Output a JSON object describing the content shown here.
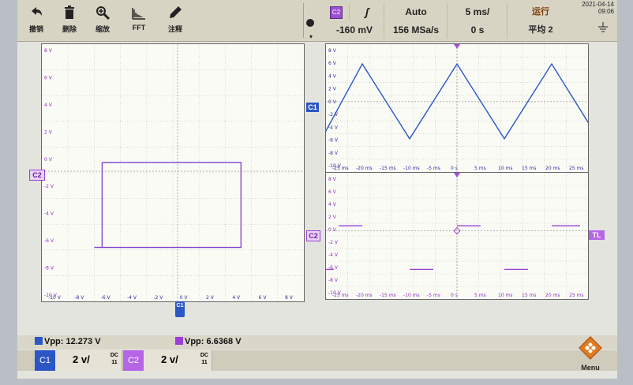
{
  "toolbar": {
    "buttons": [
      {
        "label": "撤销",
        "icon": "undo-icon"
      },
      {
        "label": "删除",
        "icon": "trash-icon"
      },
      {
        "label": "缩放",
        "icon": "zoom-icon"
      },
      {
        "label": "FFT",
        "icon": "fft-icon"
      },
      {
        "label": "注释",
        "icon": "pencil-icon"
      }
    ],
    "trigger_mode": "Auto",
    "timebase": "5 ms/",
    "run_state": "运行",
    "date": "2021-04-14",
    "time": "09:06",
    "trigger_level": "-160 mV",
    "sample_rate": "156 MSa/s",
    "delay": "0 s",
    "acquire_mode": "平均 2",
    "trigger_channel": "C2"
  },
  "xy_plot": {
    "y_ticks": [
      "8 V",
      "6 V",
      "4 V",
      "2 V",
      "0 V",
      "-2 V",
      "-4 V",
      "-6 V",
      "-8 V",
      "-10 V"
    ],
    "x_ticks": [
      "-10 V",
      "-8 V",
      "-6 V",
      "-4 V",
      "-2 V",
      "0 V",
      "2 V",
      "4 V",
      "6 V",
      "8 V"
    ],
    "y_marker": "C2"
  },
  "yt_upper": {
    "y_ticks": [
      "8 V",
      "6 V",
      "4 V",
      "2 V",
      "0 V",
      "-2 V",
      "-4 V",
      "-6 V",
      "-8 V",
      "-10 V"
    ],
    "x_ticks": [
      "-25 ms",
      "-20 ms",
      "-15 ms",
      "-10 ms",
      "-5 ms",
      "0 s",
      "5 ms",
      "10 ms",
      "15 ms",
      "20 ms",
      "25 ms"
    ],
    "marker": "C1"
  },
  "yt_lower": {
    "y_ticks": [
      "8 V",
      "6 V",
      "4 V",
      "2 V",
      "0 V",
      "-2 V",
      "-4 V",
      "-6 V",
      "-8 V",
      "-10 V"
    ],
    "x_ticks": [
      "-25 ms",
      "-20 ms",
      "-15 ms",
      "-10 ms",
      "-5 ms",
      "0 s",
      "5 ms",
      "10 ms",
      "15 ms",
      "20 ms",
      "25 ms"
    ],
    "marker": "C2",
    "trigger_marker": "TL"
  },
  "measurements": {
    "c1": "Vpp: 12.273 V",
    "c2": "Vpp: 6.6368 V"
  },
  "channels": [
    {
      "label": "C1",
      "scale": "2 v/",
      "coupling": "DC",
      "bw": "11",
      "color": "#2a56c6"
    },
    {
      "label": "C2",
      "scale": "2 v/",
      "coupling": "DC",
      "bw": "11",
      "color": "#b565e6"
    }
  ],
  "menu_label": "Menu",
  "colors": {
    "ch1": "#2a56c6",
    "ch2": "#9b3fd8",
    "grid_bg": "#fbfbf6"
  }
}
